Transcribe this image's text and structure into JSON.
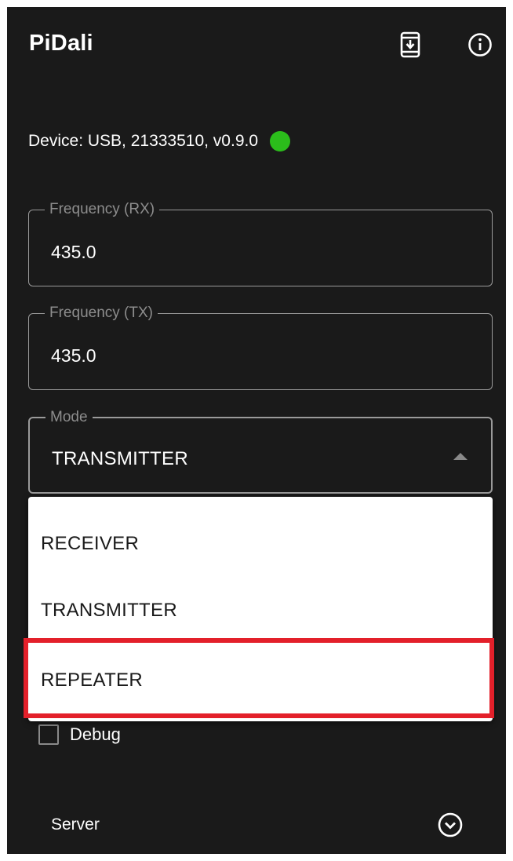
{
  "app": {
    "title": "PiDali",
    "install_icon": "install-mobile-icon",
    "info_icon": "info-icon"
  },
  "device": {
    "status_text": "Device: USB, 21333510, v0.9.0",
    "status_color": "#2bbd1b"
  },
  "fields": {
    "frequency_rx": {
      "label": "Frequency (RX)",
      "value": "435.0"
    },
    "frequency_tx": {
      "label": "Frequency (TX)",
      "value": "435.0"
    },
    "mode": {
      "label": "Mode",
      "value": "TRANSMITTER"
    }
  },
  "mode_options": [
    "RECEIVER",
    "TRANSMITTER",
    "REPEATER"
  ],
  "debug": {
    "label": "Debug",
    "checked": false
  },
  "server": {
    "label": "Server",
    "toggle_icon": "chevron-down-circle-icon"
  },
  "colors": {
    "background": "#1a1a1a",
    "highlight": "#e3202a",
    "dropdown_bg": "#ffffff"
  }
}
